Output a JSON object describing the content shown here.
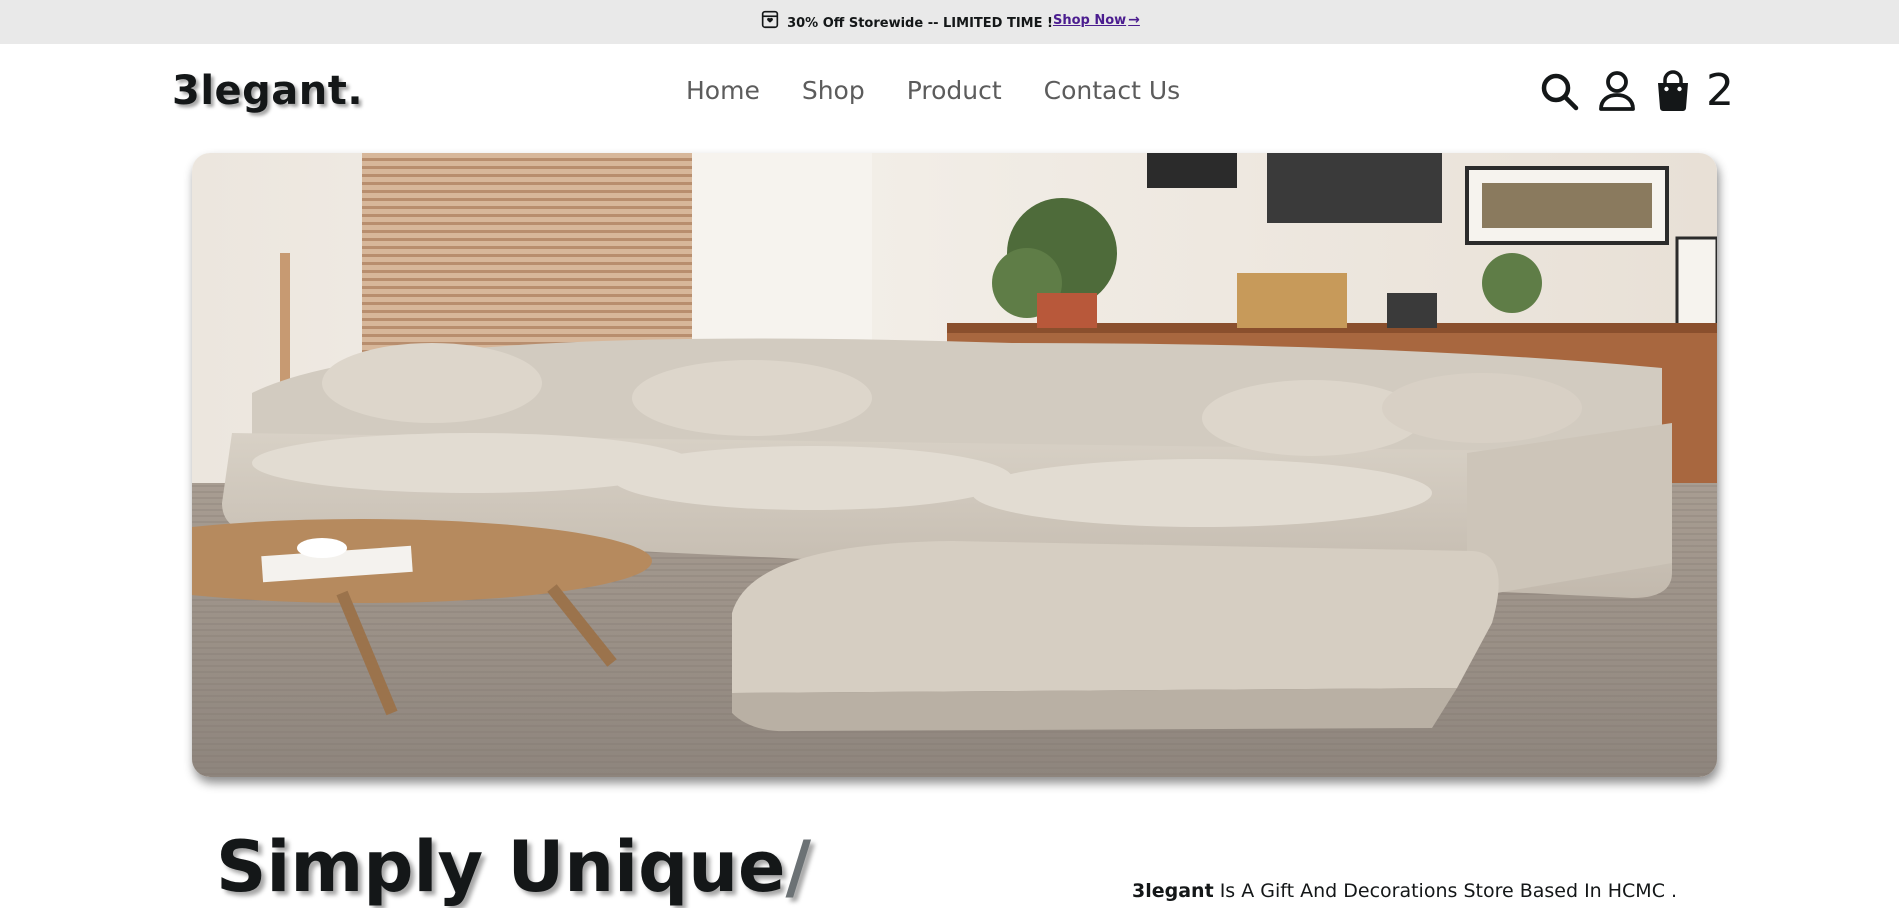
{
  "promo": {
    "text": "30% Off Storewide -- LIMITED TIME !",
    "link_label": "Shop Now",
    "icon": "gift-icon"
  },
  "header": {
    "logo": "3legant.",
    "nav": [
      "Home",
      "Shop",
      "Product",
      "Contact Us"
    ],
    "cart_count": "2"
  },
  "hero": {
    "image": "living-room-sofa-photo"
  },
  "intro": {
    "headline": "Simply Unique",
    "slash": "/",
    "brand": "3legant",
    "tagline": " Is A Gift And Decorations Store Based In HCMC ."
  },
  "colors": {
    "promo_bg": "#e9e9e9",
    "link": "#4b1d8f",
    "nav": "#5c5c5c",
    "text": "#141718"
  }
}
